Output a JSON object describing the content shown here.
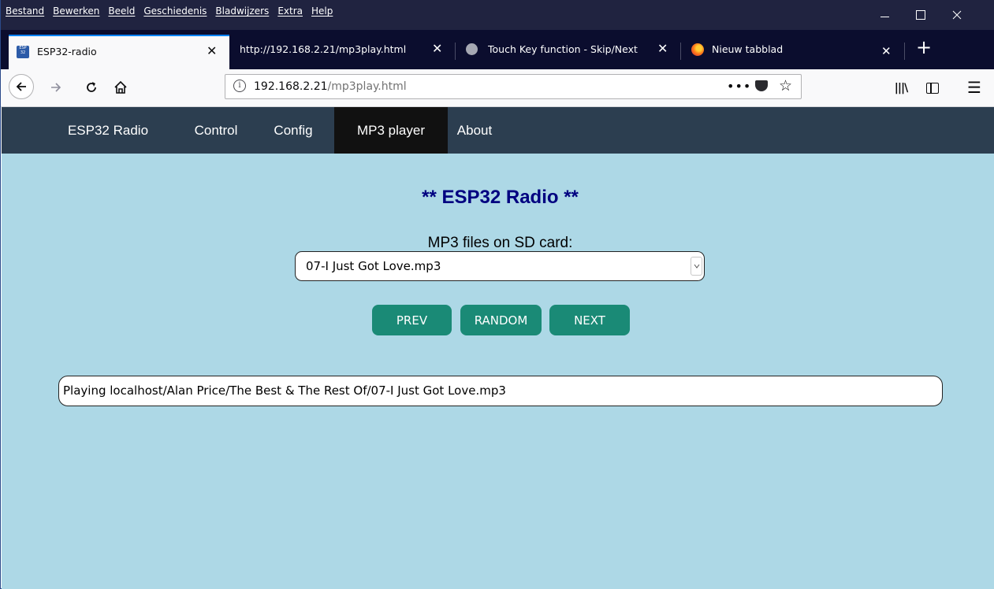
{
  "menubar": {
    "items": [
      "Bestand",
      "Bewerken",
      "Beeld",
      "Geschiedenis",
      "Bladwijzers",
      "Extra",
      "Help"
    ]
  },
  "tabs": [
    {
      "label": "ESP32-radio",
      "icon": "esp32-favicon",
      "active": true
    },
    {
      "label": "http://192.168.2.21/mp3play.html",
      "icon": "none",
      "active": false
    },
    {
      "label": "Touch Key function - Skip/Next",
      "icon": "github-favicon",
      "active": false
    },
    {
      "label": "Nieuw tabblad",
      "icon": "firefox-favicon",
      "active": false
    }
  ],
  "navbar": {
    "url_host": "192.168.2.21",
    "url_path": "/mp3play.html"
  },
  "page": {
    "nav": [
      "ESP32 Radio",
      "Control",
      "Config",
      "MP3 player",
      "About"
    ],
    "active_nav": "MP3 player",
    "title": "** ESP32 Radio **",
    "select_label": "MP3 files on SD card:",
    "selected_file": "07-I Just Got Love.mp3",
    "buttons": {
      "prev": "PREV",
      "random": "RANDOM",
      "next": "NEXT"
    },
    "status": "Playing localhost/Alan Price/The Best & The Rest Of/07-I Just Got Love.mp3"
  },
  "colors": {
    "page_bg": "#add8e6",
    "nav_bg": "#2c3e50",
    "nav_active": "#111111",
    "title": "#000080",
    "button": "#1a8a76"
  }
}
